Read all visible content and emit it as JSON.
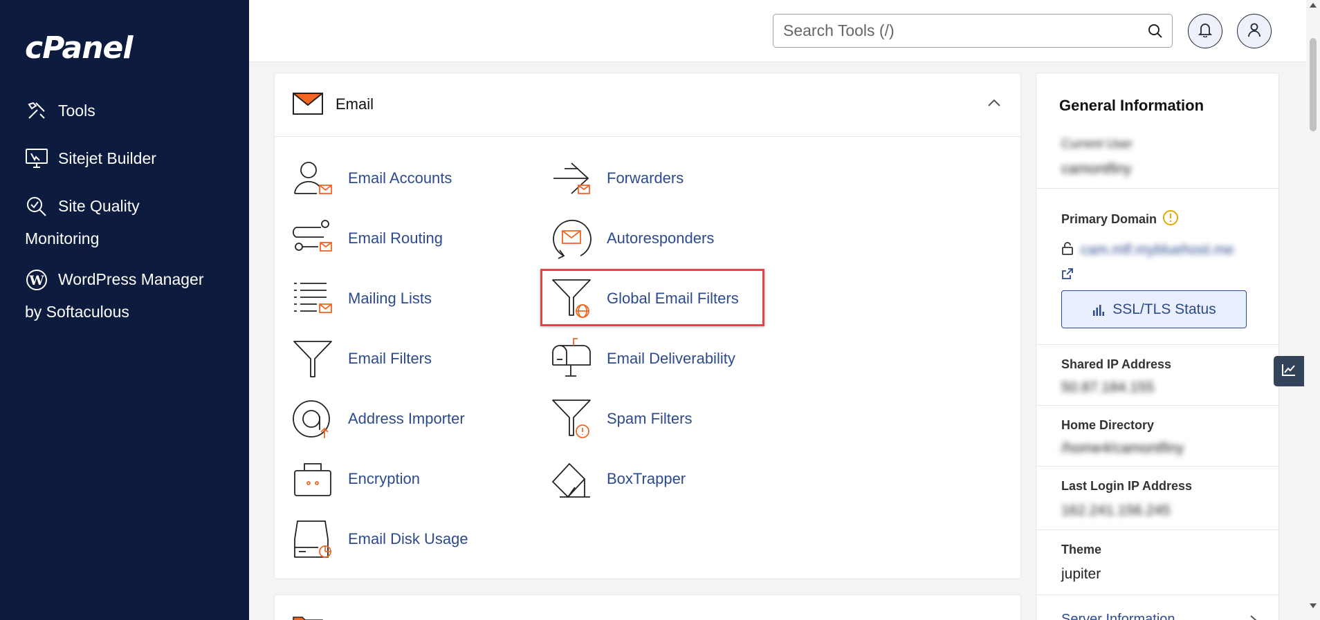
{
  "sidebar": {
    "logo": "cPanel",
    "items": [
      {
        "label": "Tools",
        "icon": "tools-icon"
      },
      {
        "label": "Sitejet Builder",
        "icon": "sitejet-icon"
      },
      {
        "label_line1": "Site Quality",
        "label_line2": "Monitoring",
        "icon": "magnifier-check-icon"
      },
      {
        "label_line1": "WordPress Manager",
        "label_line2": "by Softaculous",
        "icon": "wordpress-icon"
      }
    ]
  },
  "header": {
    "search_placeholder": "Search Tools (/)"
  },
  "email_section": {
    "title": "Email",
    "tools_left": [
      {
        "label": "Email Accounts",
        "icon": "email-accounts-icon"
      },
      {
        "label": "Email Routing",
        "icon": "email-routing-icon"
      },
      {
        "label": "Mailing Lists",
        "icon": "mailing-lists-icon"
      },
      {
        "label": "Email Filters",
        "icon": "email-filters-icon"
      },
      {
        "label": "Address Importer",
        "icon": "address-importer-icon"
      },
      {
        "label": "Encryption",
        "icon": "encryption-icon"
      },
      {
        "label": "Email Disk Usage",
        "icon": "email-disk-usage-icon"
      }
    ],
    "tools_right": [
      {
        "label": "Forwarders",
        "icon": "forwarders-icon"
      },
      {
        "label": "Autoresponders",
        "icon": "autoresponders-icon"
      },
      {
        "label": "Global Email Filters",
        "icon": "global-email-filters-icon"
      },
      {
        "label": "Email Deliverability",
        "icon": "email-deliverability-icon"
      },
      {
        "label": "Spam Filters",
        "icon": "spam-filters-icon"
      },
      {
        "label": "BoxTrapper",
        "icon": "boxtrapper-icon"
      }
    ]
  },
  "general_info": {
    "title": "General Information",
    "current_user_label": "Current User",
    "current_user_value": "camontfiny",
    "primary_domain_label": "Primary Domain",
    "primary_domain_value": "cam.mlf.mybluehost.me",
    "ssl_button": "SSL/TLS Status",
    "shared_ip_label": "Shared IP Address",
    "shared_ip_value": "50.87.184.155",
    "home_dir_label": "Home Directory",
    "home_dir_value": "/home4/camontfiny",
    "last_login_label": "Last Login IP Address",
    "last_login_value": "162.241.156.245",
    "theme_label": "Theme",
    "theme_value": "jupiter",
    "server_info_label": "Server Information"
  },
  "colors": {
    "sidebar_bg": "#0d1b3e",
    "link": "#2d4a8e",
    "accent_orange": "#f26522",
    "highlight_border": "#e0454a"
  }
}
